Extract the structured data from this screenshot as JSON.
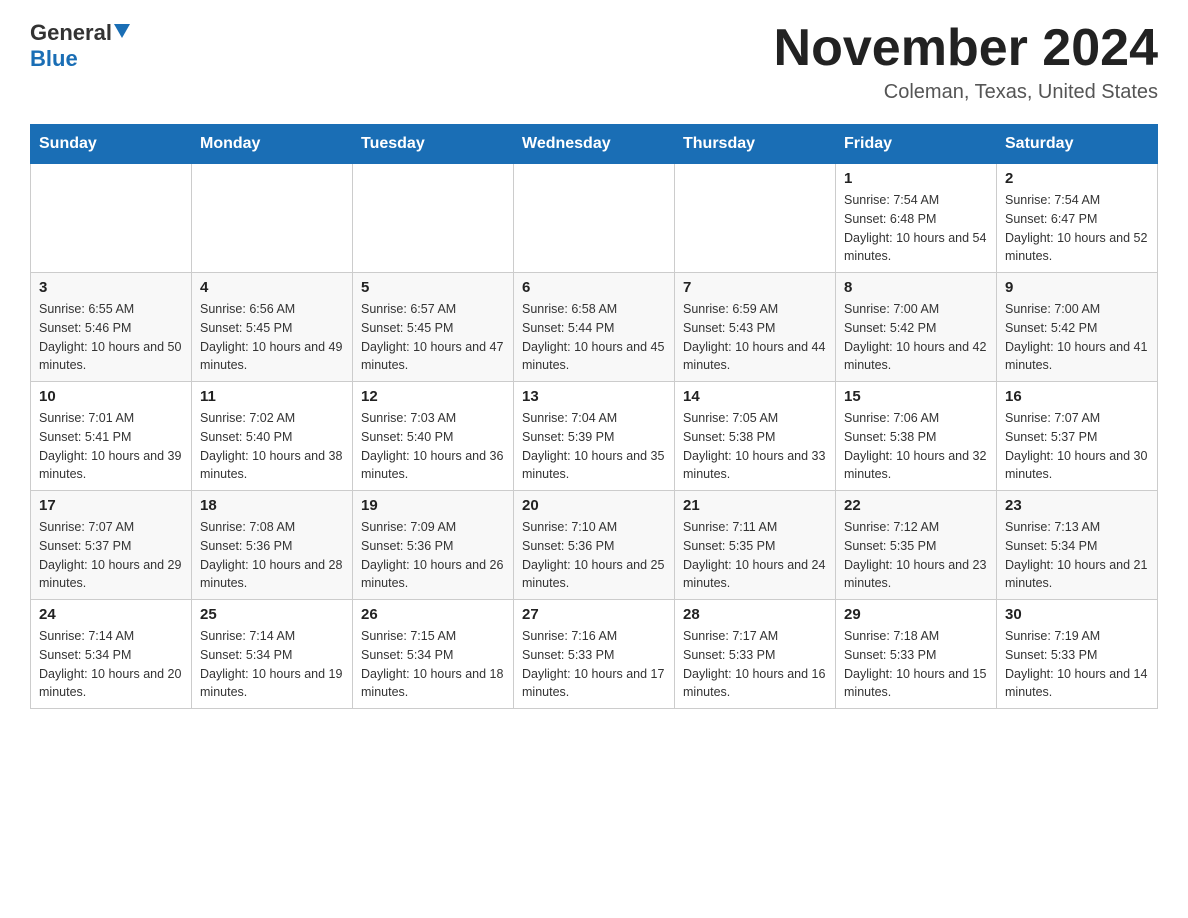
{
  "header": {
    "logo_general": "General",
    "logo_blue": "Blue",
    "month_title": "November 2024",
    "location": "Coleman, Texas, United States"
  },
  "weekdays": [
    "Sunday",
    "Monday",
    "Tuesday",
    "Wednesday",
    "Thursday",
    "Friday",
    "Saturday"
  ],
  "weeks": [
    [
      {
        "day": "",
        "sunrise": "",
        "sunset": "",
        "daylight": ""
      },
      {
        "day": "",
        "sunrise": "",
        "sunset": "",
        "daylight": ""
      },
      {
        "day": "",
        "sunrise": "",
        "sunset": "",
        "daylight": ""
      },
      {
        "day": "",
        "sunrise": "",
        "sunset": "",
        "daylight": ""
      },
      {
        "day": "",
        "sunrise": "",
        "sunset": "",
        "daylight": ""
      },
      {
        "day": "1",
        "sunrise": "Sunrise: 7:54 AM",
        "sunset": "Sunset: 6:48 PM",
        "daylight": "Daylight: 10 hours and 54 minutes."
      },
      {
        "day": "2",
        "sunrise": "Sunrise: 7:54 AM",
        "sunset": "Sunset: 6:47 PM",
        "daylight": "Daylight: 10 hours and 52 minutes."
      }
    ],
    [
      {
        "day": "3",
        "sunrise": "Sunrise: 6:55 AM",
        "sunset": "Sunset: 5:46 PM",
        "daylight": "Daylight: 10 hours and 50 minutes."
      },
      {
        "day": "4",
        "sunrise": "Sunrise: 6:56 AM",
        "sunset": "Sunset: 5:45 PM",
        "daylight": "Daylight: 10 hours and 49 minutes."
      },
      {
        "day": "5",
        "sunrise": "Sunrise: 6:57 AM",
        "sunset": "Sunset: 5:45 PM",
        "daylight": "Daylight: 10 hours and 47 minutes."
      },
      {
        "day": "6",
        "sunrise": "Sunrise: 6:58 AM",
        "sunset": "Sunset: 5:44 PM",
        "daylight": "Daylight: 10 hours and 45 minutes."
      },
      {
        "day": "7",
        "sunrise": "Sunrise: 6:59 AM",
        "sunset": "Sunset: 5:43 PM",
        "daylight": "Daylight: 10 hours and 44 minutes."
      },
      {
        "day": "8",
        "sunrise": "Sunrise: 7:00 AM",
        "sunset": "Sunset: 5:42 PM",
        "daylight": "Daylight: 10 hours and 42 minutes."
      },
      {
        "day": "9",
        "sunrise": "Sunrise: 7:00 AM",
        "sunset": "Sunset: 5:42 PM",
        "daylight": "Daylight: 10 hours and 41 minutes."
      }
    ],
    [
      {
        "day": "10",
        "sunrise": "Sunrise: 7:01 AM",
        "sunset": "Sunset: 5:41 PM",
        "daylight": "Daylight: 10 hours and 39 minutes."
      },
      {
        "day": "11",
        "sunrise": "Sunrise: 7:02 AM",
        "sunset": "Sunset: 5:40 PM",
        "daylight": "Daylight: 10 hours and 38 minutes."
      },
      {
        "day": "12",
        "sunrise": "Sunrise: 7:03 AM",
        "sunset": "Sunset: 5:40 PM",
        "daylight": "Daylight: 10 hours and 36 minutes."
      },
      {
        "day": "13",
        "sunrise": "Sunrise: 7:04 AM",
        "sunset": "Sunset: 5:39 PM",
        "daylight": "Daylight: 10 hours and 35 minutes."
      },
      {
        "day": "14",
        "sunrise": "Sunrise: 7:05 AM",
        "sunset": "Sunset: 5:38 PM",
        "daylight": "Daylight: 10 hours and 33 minutes."
      },
      {
        "day": "15",
        "sunrise": "Sunrise: 7:06 AM",
        "sunset": "Sunset: 5:38 PM",
        "daylight": "Daylight: 10 hours and 32 minutes."
      },
      {
        "day": "16",
        "sunrise": "Sunrise: 7:07 AM",
        "sunset": "Sunset: 5:37 PM",
        "daylight": "Daylight: 10 hours and 30 minutes."
      }
    ],
    [
      {
        "day": "17",
        "sunrise": "Sunrise: 7:07 AM",
        "sunset": "Sunset: 5:37 PM",
        "daylight": "Daylight: 10 hours and 29 minutes."
      },
      {
        "day": "18",
        "sunrise": "Sunrise: 7:08 AM",
        "sunset": "Sunset: 5:36 PM",
        "daylight": "Daylight: 10 hours and 28 minutes."
      },
      {
        "day": "19",
        "sunrise": "Sunrise: 7:09 AM",
        "sunset": "Sunset: 5:36 PM",
        "daylight": "Daylight: 10 hours and 26 minutes."
      },
      {
        "day": "20",
        "sunrise": "Sunrise: 7:10 AM",
        "sunset": "Sunset: 5:36 PM",
        "daylight": "Daylight: 10 hours and 25 minutes."
      },
      {
        "day": "21",
        "sunrise": "Sunrise: 7:11 AM",
        "sunset": "Sunset: 5:35 PM",
        "daylight": "Daylight: 10 hours and 24 minutes."
      },
      {
        "day": "22",
        "sunrise": "Sunrise: 7:12 AM",
        "sunset": "Sunset: 5:35 PM",
        "daylight": "Daylight: 10 hours and 23 minutes."
      },
      {
        "day": "23",
        "sunrise": "Sunrise: 7:13 AM",
        "sunset": "Sunset: 5:34 PM",
        "daylight": "Daylight: 10 hours and 21 minutes."
      }
    ],
    [
      {
        "day": "24",
        "sunrise": "Sunrise: 7:14 AM",
        "sunset": "Sunset: 5:34 PM",
        "daylight": "Daylight: 10 hours and 20 minutes."
      },
      {
        "day": "25",
        "sunrise": "Sunrise: 7:14 AM",
        "sunset": "Sunset: 5:34 PM",
        "daylight": "Daylight: 10 hours and 19 minutes."
      },
      {
        "day": "26",
        "sunrise": "Sunrise: 7:15 AM",
        "sunset": "Sunset: 5:34 PM",
        "daylight": "Daylight: 10 hours and 18 minutes."
      },
      {
        "day": "27",
        "sunrise": "Sunrise: 7:16 AM",
        "sunset": "Sunset: 5:33 PM",
        "daylight": "Daylight: 10 hours and 17 minutes."
      },
      {
        "day": "28",
        "sunrise": "Sunrise: 7:17 AM",
        "sunset": "Sunset: 5:33 PM",
        "daylight": "Daylight: 10 hours and 16 minutes."
      },
      {
        "day": "29",
        "sunrise": "Sunrise: 7:18 AM",
        "sunset": "Sunset: 5:33 PM",
        "daylight": "Daylight: 10 hours and 15 minutes."
      },
      {
        "day": "30",
        "sunrise": "Sunrise: 7:19 AM",
        "sunset": "Sunset: 5:33 PM",
        "daylight": "Daylight: 10 hours and 14 minutes."
      }
    ]
  ]
}
